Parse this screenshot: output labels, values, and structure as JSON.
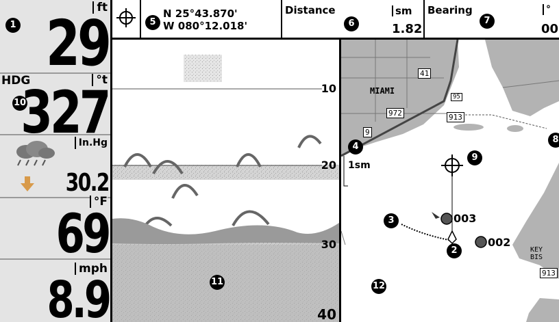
{
  "readouts": {
    "depth": {
      "unit": "ft",
      "value": "29"
    },
    "heading": {
      "label": "HDG",
      "unit": "°t",
      "value": "327"
    },
    "pressure": {
      "unit": "In.Hg",
      "value": "30.2"
    },
    "water_temp": {
      "unit": "°F",
      "value": "69"
    },
    "speed": {
      "unit": "mph",
      "value": "8.9"
    }
  },
  "navbar": {
    "lat": "N 25°43.870'",
    "lon": "W 080°12.018'",
    "distance_label": "Distance",
    "distance_unit": "sm",
    "distance_value": "1.82",
    "bearing_label": "Bearing",
    "bearing_unit": "°",
    "bearing_value": "00"
  },
  "sonar": {
    "depth_labels": [
      "10",
      "20",
      "30",
      "40"
    ]
  },
  "chart": {
    "city": "MIAMI",
    "scale": "1sm",
    "roads": [
      "41",
      "95",
      "972",
      "913",
      "9",
      "913"
    ],
    "place": "KEY BIS",
    "waypoints": [
      {
        "name": "003"
      },
      {
        "name": "002"
      }
    ]
  },
  "callouts": [
    "1",
    "2",
    "3",
    "4",
    "5",
    "6",
    "7",
    "8",
    "9",
    "10",
    "11",
    "12"
  ],
  "colors": {
    "panel_bg": "#e4e4e4",
    "land": "#b3b3b3",
    "water": "#ffffff",
    "watermark": "#f3c873"
  }
}
